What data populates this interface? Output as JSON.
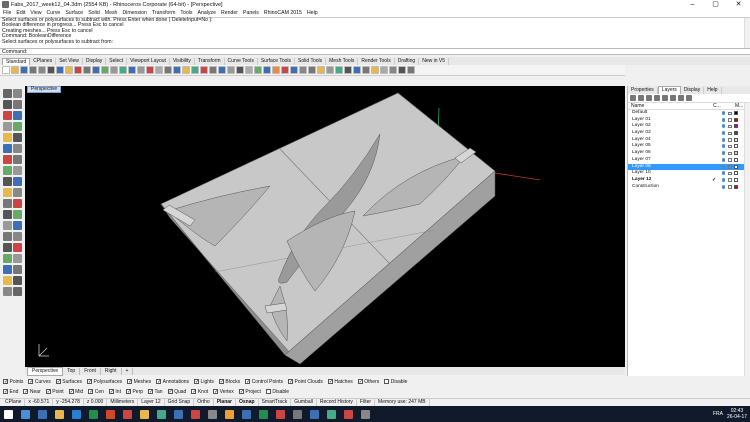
{
  "window": {
    "title": "Fabs_2017_week12_04.3dm (2554 KB) - Rhinoceros Corporate (64-bit) - [Perspective]",
    "buttons": [
      "–",
      "▢",
      "✕"
    ]
  },
  "menu": [
    "File",
    "Edit",
    "View",
    "Curve",
    "Surface",
    "Solid",
    "Mesh",
    "Dimension",
    "Transform",
    "Tools",
    "Analyze",
    "Render",
    "Panels",
    "RhinoCAM 2015",
    "Help"
  ],
  "command_history": [
    "Select surfaces or polysurfaces to subtract with. Press Enter when done ( DeleteInput=No ):",
    "Boolean difference in progress... Press Esc to cancel",
    "Creating meshes... Press Esc to cancel",
    "Command: BooleanDifference",
    "Select surfaces or polysurfaces to subtract from:"
  ],
  "command_prompt": "Command:",
  "toolbar_tabs": [
    "Standard",
    "CPlanes",
    "Set View",
    "Display",
    "Select",
    "Viewport Layout",
    "Visibility",
    "Transform",
    "Curve Tools",
    "Surface Tools",
    "Solid Tools",
    "Mesh Tools",
    "Render Tools",
    "Drafting",
    "New in V5"
  ],
  "viewport": {
    "name": "Perspective",
    "tabs": [
      "Perspective",
      "Top",
      "Front",
      "Right",
      "+"
    ]
  },
  "panel": {
    "tabs": [
      "Properties",
      "Layers",
      "Display",
      "Help"
    ],
    "columns": [
      "Name",
      "C...",
      "M..."
    ],
    "layers": [
      {
        "name": "Default",
        "color": "#000000"
      },
      {
        "name": "Layer 01",
        "color": "#cc0000"
      },
      {
        "name": "Layer 02",
        "color": "#aa00aa"
      },
      {
        "name": "Layer 03",
        "color": "#3030cc"
      },
      {
        "name": "Layer 04",
        "color": "#e0e0e0"
      },
      {
        "name": "Layer 05",
        "color": "#ffffff"
      },
      {
        "name": "Layer 06",
        "color": "#c8c8ff"
      },
      {
        "name": "Layer 07",
        "color": "#ffffff"
      },
      {
        "name": "Layer 08",
        "color": "#ffffff"
      },
      {
        "name": "Layer 10",
        "color": "#ffffff"
      },
      {
        "name": "Layer 12",
        "color": "#ffffff"
      },
      {
        "name": "Construction",
        "color": "#cc0000"
      }
    ],
    "selected_layer": "Layer 08",
    "current_layer": "Layer 12"
  },
  "osnap_row1": [
    "Points",
    "Curves",
    "Surfaces",
    "Polysurfaces",
    "Meshes",
    "Annotations",
    "Lights",
    "Blocks",
    "Control Points",
    "Point Clouds",
    "Hatches",
    "Others",
    "Disable"
  ],
  "osnap_row2": [
    "End",
    "Near",
    "Point",
    "Mid",
    "Cen",
    "Int",
    "Perp",
    "Tan",
    "Quad",
    "Knot",
    "Vertex",
    "Project",
    "Disable"
  ],
  "status": {
    "cplane": "CPlane",
    "x": "x -60.571",
    "y": "y -254.278",
    "z": "z 0.000",
    "units": "Millimeters",
    "layer": "Layer 12",
    "toggles": [
      "Grid Snap",
      "Ortho",
      "Planar",
      "Osnap",
      "SmartTrack",
      "Gumball",
      "Record History",
      "Filter"
    ],
    "memory": "Memory use: 247 MB"
  },
  "taskbar": {
    "language": "FRA",
    "time": "02:43",
    "date": "26-04-17"
  }
}
